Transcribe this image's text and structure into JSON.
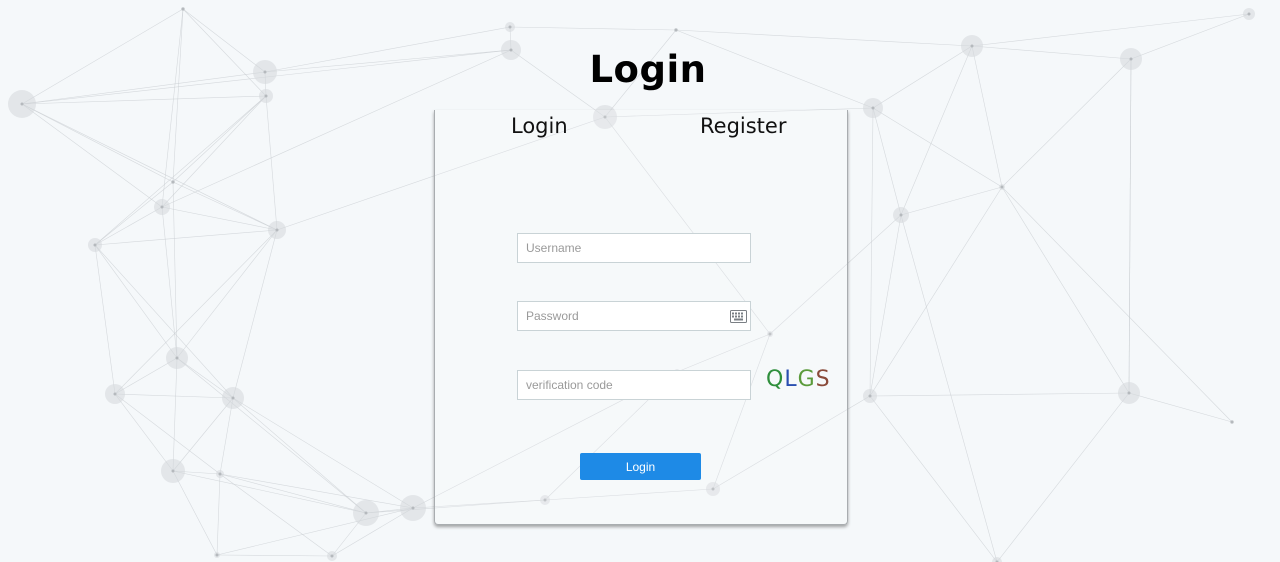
{
  "page": {
    "title": "Login"
  },
  "tabs": {
    "login_label": "Login",
    "register_label": "Register"
  },
  "form": {
    "username_placeholder": "Username",
    "username_value": "",
    "password_placeholder": "Password",
    "password_value": "",
    "code_placeholder": "verification code",
    "code_value": "",
    "captcha_text": "QLGS",
    "captcha_chars": [
      "Q",
      "L",
      "G",
      "S"
    ],
    "submit_label": "Login"
  },
  "icons": {
    "keyboard": "keyboard-icon"
  },
  "colors": {
    "background": "#f5f8fa",
    "button": "#1e8ae6",
    "network_lines": "#c8ccd0",
    "captcha": [
      "#2f8f3c",
      "#2a4fb0",
      "#5b9b3b",
      "#8a4b3a"
    ]
  }
}
